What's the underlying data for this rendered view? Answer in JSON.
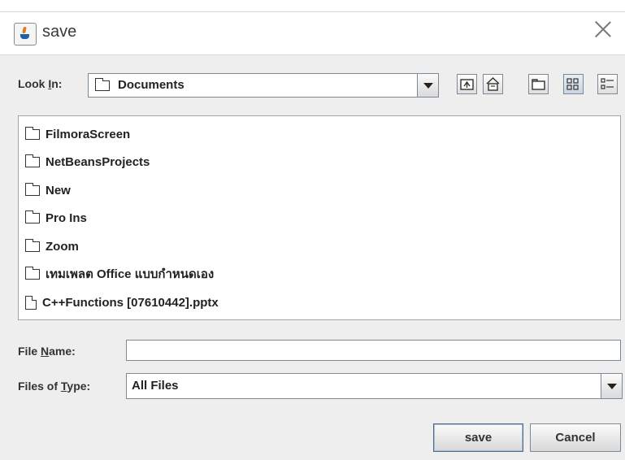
{
  "window": {
    "title": "save",
    "icon": "java-cup-icon"
  },
  "look_in": {
    "label_prefix": "Look ",
    "label_mnemonic": "I",
    "label_suffix": "n:",
    "value": "Documents",
    "toolbar": [
      {
        "name": "up-one-level-button",
        "icon": "up-folder-icon"
      },
      {
        "name": "home-button",
        "icon": "home-icon"
      },
      {
        "name": "new-folder-button",
        "icon": "new-folder-icon"
      },
      {
        "name": "list-view-button",
        "icon": "list-view-icon",
        "selected": true
      },
      {
        "name": "details-view-button",
        "icon": "details-view-icon"
      }
    ]
  },
  "files": [
    {
      "name": "FilmoraScreen",
      "type": "folder"
    },
    {
      "name": "NetBeansProjects",
      "type": "folder"
    },
    {
      "name": "New",
      "type": "folder"
    },
    {
      "name": "Pro Ins",
      "type": "folder"
    },
    {
      "name": "Zoom",
      "type": "folder"
    },
    {
      "name": "เทมเพลต Office แบบกำหนดเอง",
      "type": "folder"
    },
    {
      "name": "C++Functions [07610442].pptx",
      "type": "file"
    }
  ],
  "file_name": {
    "label_prefix": "File ",
    "label_mnemonic": "N",
    "label_suffix": "ame:",
    "value": ""
  },
  "files_of_type": {
    "label_prefix": "Files of ",
    "label_mnemonic": "T",
    "label_suffix": "ype:",
    "value": "All Files"
  },
  "buttons": {
    "save": "save",
    "cancel": "Cancel"
  }
}
